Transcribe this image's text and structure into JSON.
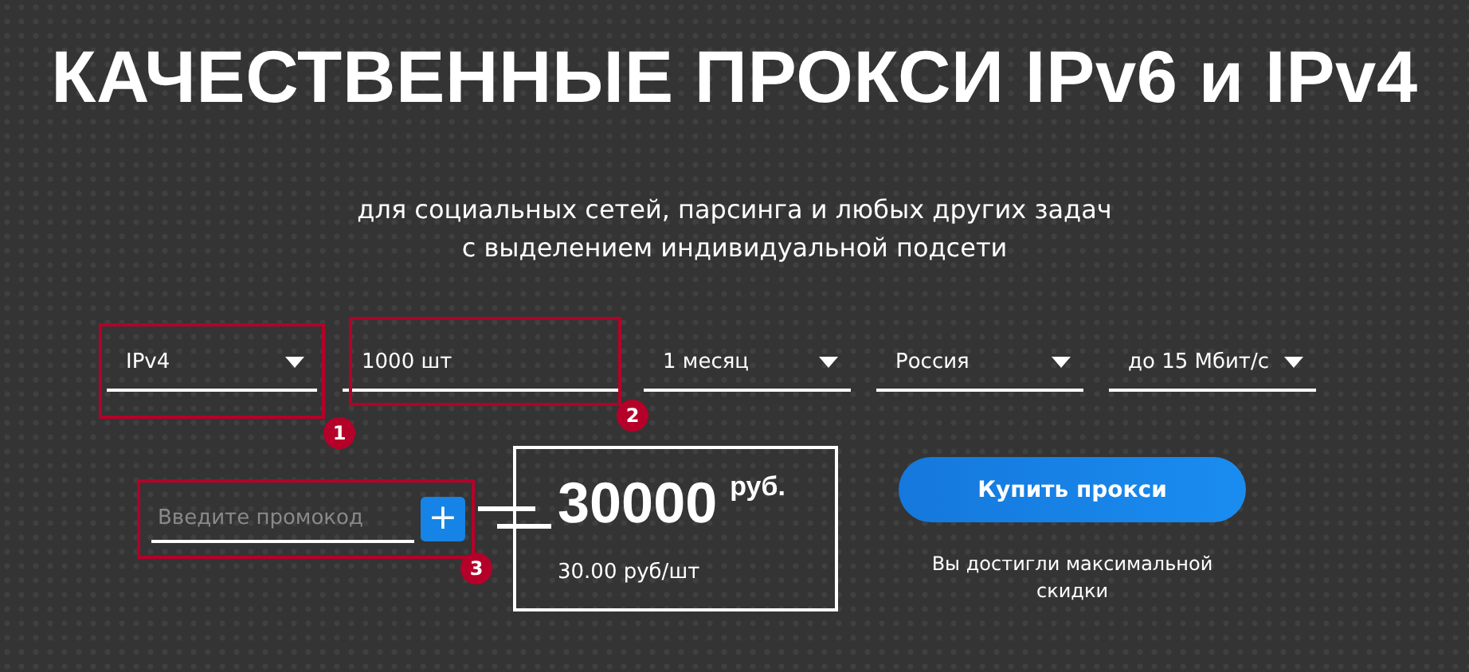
{
  "title": "КАЧЕСТВЕННЫЕ ПРОКСИ IPv6 и IPv4",
  "subtitle": [
    "для социальных сетей, парсинга и любых других задач",
    "с выделением индивидуальной подсети"
  ],
  "fields": [
    {
      "kind": "select",
      "value": "IPv4",
      "marker": "1"
    },
    {
      "kind": "input",
      "value": "1000 шт",
      "marker": "2"
    },
    {
      "kind": "select",
      "value": "1 месяц"
    },
    {
      "kind": "select",
      "value": "Россия"
    },
    {
      "kind": "select",
      "value": "до 15 Мбит/с"
    }
  ],
  "promo": {
    "placeholder": "Введите промокод",
    "button": "+",
    "marker": "3"
  },
  "price": {
    "amount": "30000",
    "currency": "руб.",
    "unit_price": "30.00 руб/шт"
  },
  "buy_button": "Купить прокси",
  "note": "Вы достигли максимальной скидки"
}
